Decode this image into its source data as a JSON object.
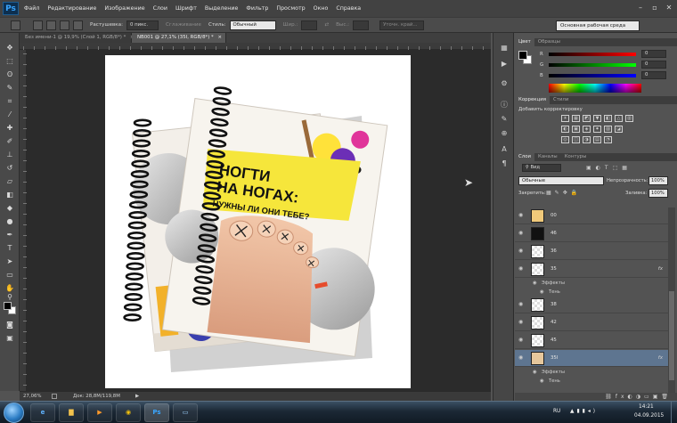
{
  "app": {
    "logo": "Ps",
    "menu": [
      "Файл",
      "Редактирование",
      "Изображение",
      "Слои",
      "Шрифт",
      "Выделение",
      "Фильтр",
      "Просмотр",
      "Окно",
      "Справка"
    ]
  },
  "options_bar": {
    "feather_label": "Растушевка:",
    "feather_value": "0 пикс.",
    "antialias_label": "Сглаживание",
    "style_label": "Стиль:",
    "style_value": "Обычный",
    "width_label": "Шир.:",
    "height_label": "Выс.:",
    "refine_label": "Уточн. край...",
    "workspace": "Основная рабочая среда"
  },
  "tabs": [
    {
      "label": "Без имени-1 @ 19,9% (Слой 1, RGB/8*) *",
      "close": "×"
    },
    {
      "label": "NB001 @ 27,1% (35I, RGB/8*) *",
      "close": "×"
    }
  ],
  "status": {
    "zoom": "27,06%",
    "doc": "Док: 28,8M/119,8M",
    "arrow": "▶"
  },
  "color_panel": {
    "tabs": [
      "Цвет",
      "Образцы"
    ],
    "channels": [
      {
        "label": "R",
        "value": "0",
        "color": "#ff0000"
      },
      {
        "label": "G",
        "value": "0",
        "color": "#00ff00"
      },
      {
        "label": "B",
        "value": "0",
        "color": "#0000ff"
      }
    ]
  },
  "adjustments_panel": {
    "tabs": [
      "Коррекция",
      "Стили"
    ],
    "add_label": "Добавить корректировку"
  },
  "layers_panel": {
    "tabs": [
      "Слои",
      "Каналы",
      "Контуры"
    ],
    "filter_label": "Вид",
    "blend_mode": "Обычные",
    "opacity_label": "Непрозрачность:",
    "opacity_value": "100%",
    "lock_label": "Закрепить:",
    "fill_label": "Заливка:",
    "fill_value": "100%",
    "layers": [
      {
        "name": "00",
        "thumb": "#f0c97a"
      },
      {
        "name": "46",
        "thumb": "#111111"
      },
      {
        "name": "36",
        "thumb": "#ffffff"
      },
      {
        "name": "35",
        "thumb": "#ffffff",
        "fx": "fx",
        "effects": [
          "Эффекты",
          "Тень"
        ]
      },
      {
        "name": "38",
        "thumb": "#ffffff"
      },
      {
        "name": "42",
        "thumb": "#ffffff"
      },
      {
        "name": "45",
        "thumb": "#ffffff"
      },
      {
        "name": "35I",
        "thumb": "#e6c79c",
        "fx": "fx",
        "selected": true,
        "effects": [
          "Эффекты",
          "Тень"
        ]
      }
    ]
  },
  "artwork": {
    "title_line1": "НОГТИ",
    "title_line2": "НА НОГАХ:",
    "subtitle": "НУЖНЫ ЛИ ОНИ ТЕБЕ?"
  },
  "taskbar": {
    "lang": "RU",
    "time": "14:21",
    "date": "04.09.2015",
    "apps": [
      "Internet Explorer",
      "Проводник",
      "Media Player",
      "Chrome",
      "Photoshop",
      "Окно"
    ]
  }
}
